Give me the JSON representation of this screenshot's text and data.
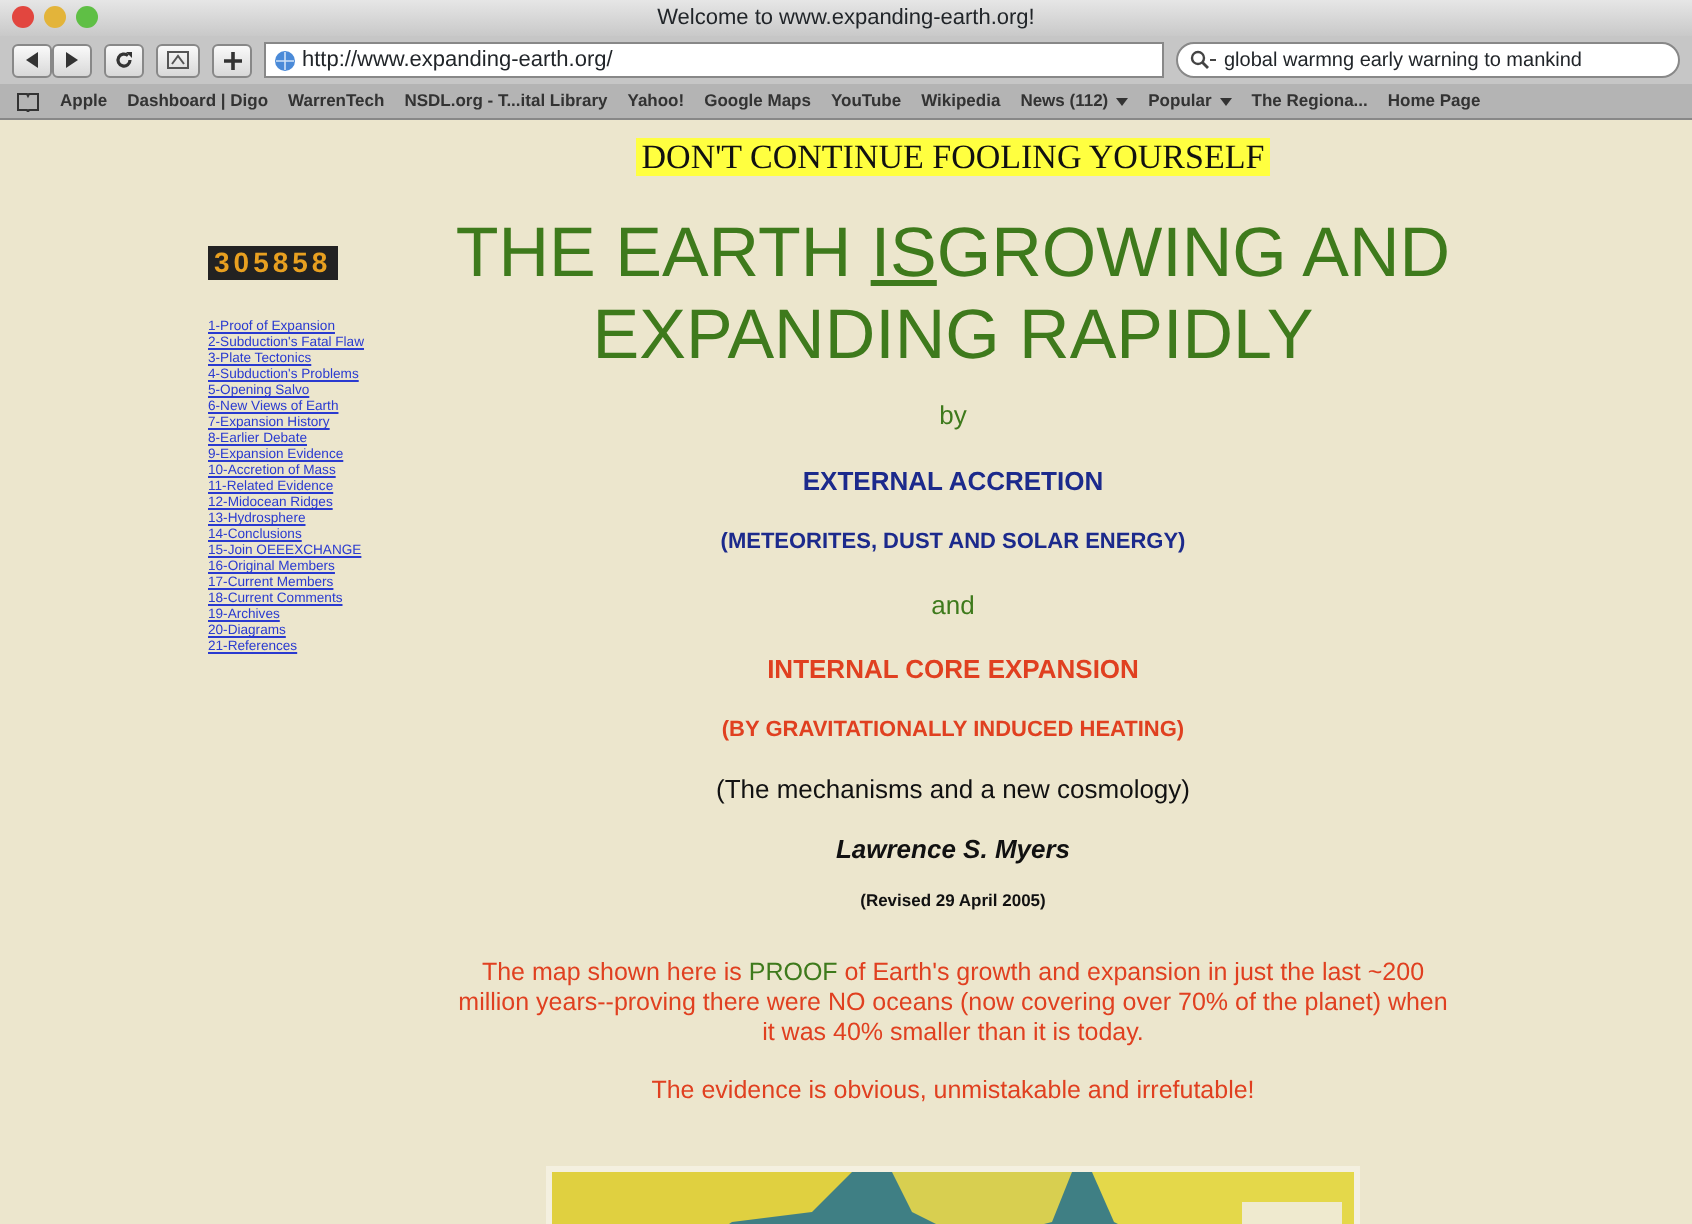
{
  "window": {
    "title": "Welcome to www.expanding-earth.org!"
  },
  "toolbar": {
    "address": "http://www.expanding-earth.org/",
    "search": "global warmng early warning to mankind"
  },
  "bookmarks": [
    {
      "label": "Apple"
    },
    {
      "label": "Dashboard | Digo"
    },
    {
      "label": "WarrenTech"
    },
    {
      "label": "NSDL.org - T...ital Library"
    },
    {
      "label": "Yahoo!"
    },
    {
      "label": "Google Maps"
    },
    {
      "label": "YouTube"
    },
    {
      "label": "Wikipedia"
    },
    {
      "label": "News (112)",
      "menu": true
    },
    {
      "label": "Popular",
      "menu": true
    },
    {
      "label": "The Regiona..."
    },
    {
      "label": "Home Page"
    }
  ],
  "counter": "305858",
  "links": [
    "1-Proof of Expansion",
    "2-Subduction's Fatal Flaw",
    "3-Plate Tectonics",
    "4-Subduction's Problems",
    "5-Opening Salvo",
    "6-New Views of Earth",
    "7-Expansion History",
    "8-Earlier Debate",
    "9-Expansion Evidence",
    "10-Accretion of Mass",
    "11-Related Evidence",
    "12-Midocean Ridges",
    "13-Hydrosphere",
    "14-Conclusions",
    "15-Join OEEEXCHANGE",
    "16-Original Members",
    "17-Current Members",
    "18-Current Comments",
    "19-Archives",
    "20-Diagrams",
    "21-References"
  ],
  "tagline": "DON'T CONTINUE FOOLING YOURSELF",
  "headline": {
    "before": "THE EARTH ",
    "underlined": "IS",
    "after": "GROWING AND EXPANDING RAPIDLY"
  },
  "lines": [
    {
      "text": "by",
      "kind": "green"
    },
    {
      "text": "EXTERNAL ACCRETION",
      "kind": "blue-large"
    },
    {
      "text": "(METEORITES, DUST AND SOLAR ENERGY)",
      "kind": "blue"
    },
    {
      "text": "and",
      "kind": "green"
    },
    {
      "text": "INTERNAL CORE EXPANSION",
      "kind": "red-large"
    },
    {
      "text": "(BY GRAVITATIONALLY INDUCED HEATING)",
      "kind": "red"
    },
    {
      "text": "(The mechanisms and a new cosmology)",
      "kind": "plain"
    },
    {
      "text": "Lawrence S. Myers",
      "kind": "author"
    },
    {
      "text": "(Revised 29 April 2005)",
      "kind": "small"
    }
  ],
  "intro": {
    "before": "The map shown here is ",
    "highlight": "PROOF",
    "after": " of Earth's growth and expansion in just the last ~200 million years--proving there were NO oceans (now covering over 70% of the planet) when it was 40% smaller than it is today."
  },
  "evidence": "The evidence is obvious, unmistakable and irrefutable!"
}
